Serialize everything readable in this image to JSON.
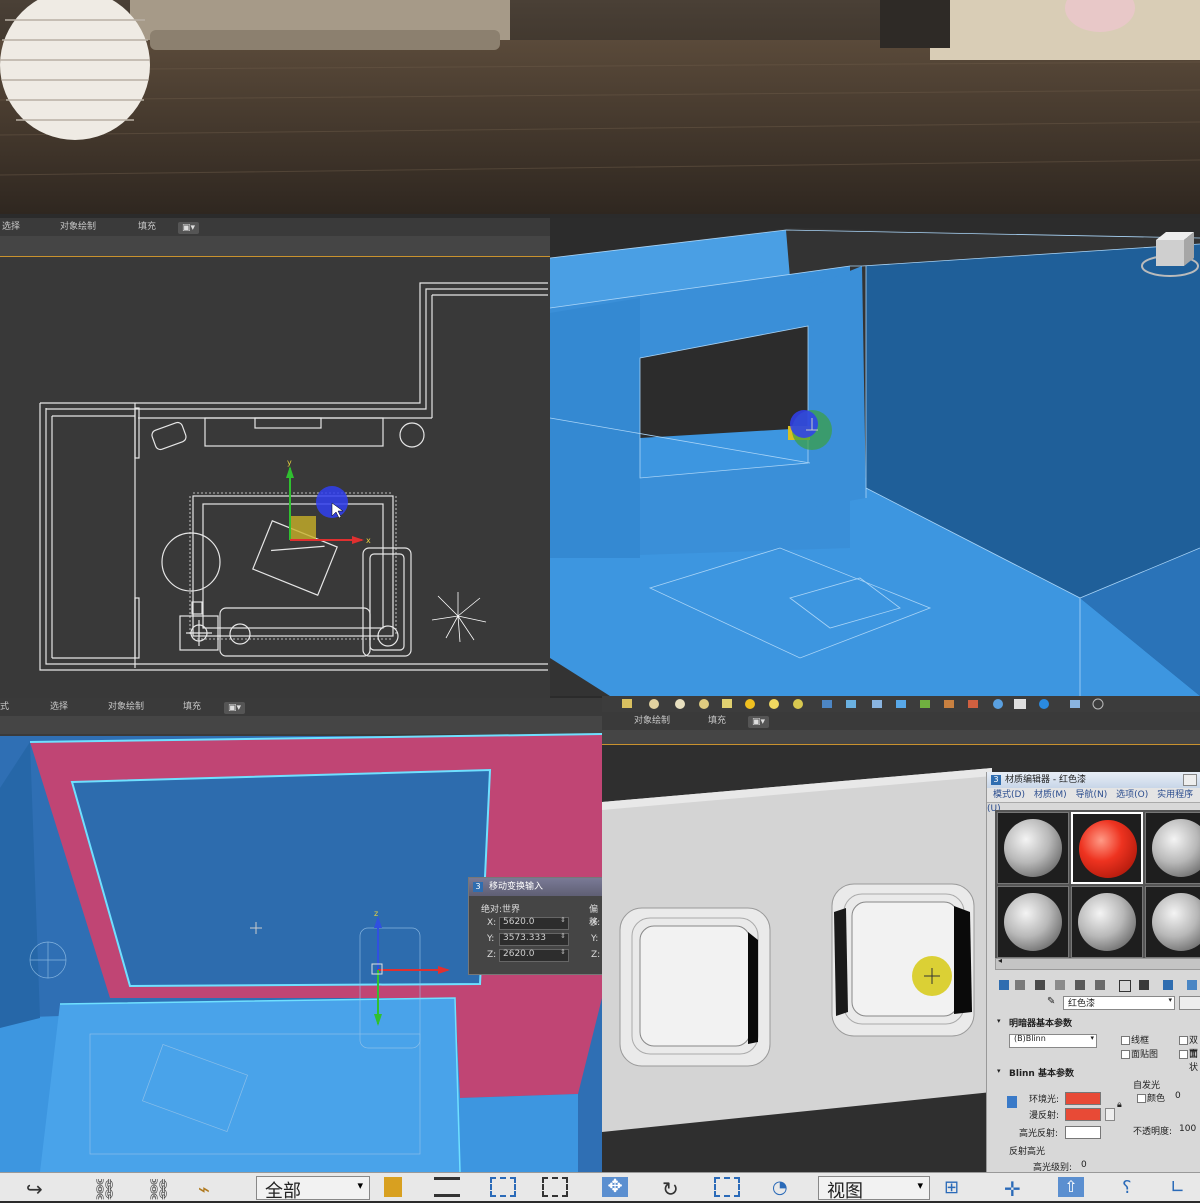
{
  "viewport_toolbar": {
    "select_label": "选择",
    "object_paint_label": "对象绘制",
    "fill_label": "填充",
    "partial_select_label": "式"
  },
  "move_transform_dialog": {
    "badge": "3",
    "title": "移动变换输入",
    "section_absolute": "绝对:世界",
    "section_offset": "偏移",
    "x_label": "X:",
    "x_value": "5620.0",
    "y_label": "Y:",
    "y_value": "3573.333",
    "z_label": "Z:",
    "z_value": "2620.0"
  },
  "material_editor": {
    "badge": "3",
    "title": "材质编辑器 - 红色漆",
    "menu": [
      "模式(D)",
      "材质(M)",
      "导航(N)",
      "选项(O)",
      "实用程序(U)"
    ],
    "material_name": "红色漆",
    "shader_section": "明暗器基本参数",
    "shader_value": "(B)Blinn",
    "wire_label": "线框",
    "two_sided_label": "双面",
    "face_map_label": "面贴图",
    "faceted_label": "面状",
    "blinn_section": "Blinn 基本参数",
    "self_illum_label": "自发光",
    "color_label": "颜色",
    "color_value": "0",
    "ambient_label": "环境光:",
    "diffuse_label": "漫反射:",
    "specular_label": "高光反射:",
    "opacity_label": "不透明度:",
    "opacity_value": "100",
    "reflect_section": "反射高光",
    "spec_level_label": "高光级别:",
    "spec_level_value": "0",
    "ambient_color": "#e84a36",
    "diffuse_color": "#e84a36",
    "specular_color": "#ffffff"
  },
  "bottom_toolbar": {
    "selection_filter": "全部",
    "reference_coord": "视图"
  },
  "colors": {
    "selection_blue": "#3d96e0",
    "selection_pink": "#c04574",
    "gizmo_x": "#e03030",
    "gizmo_y": "#30c030",
    "gizmo_z": "#3050e0",
    "toolbar_orange": "#c9922e"
  }
}
